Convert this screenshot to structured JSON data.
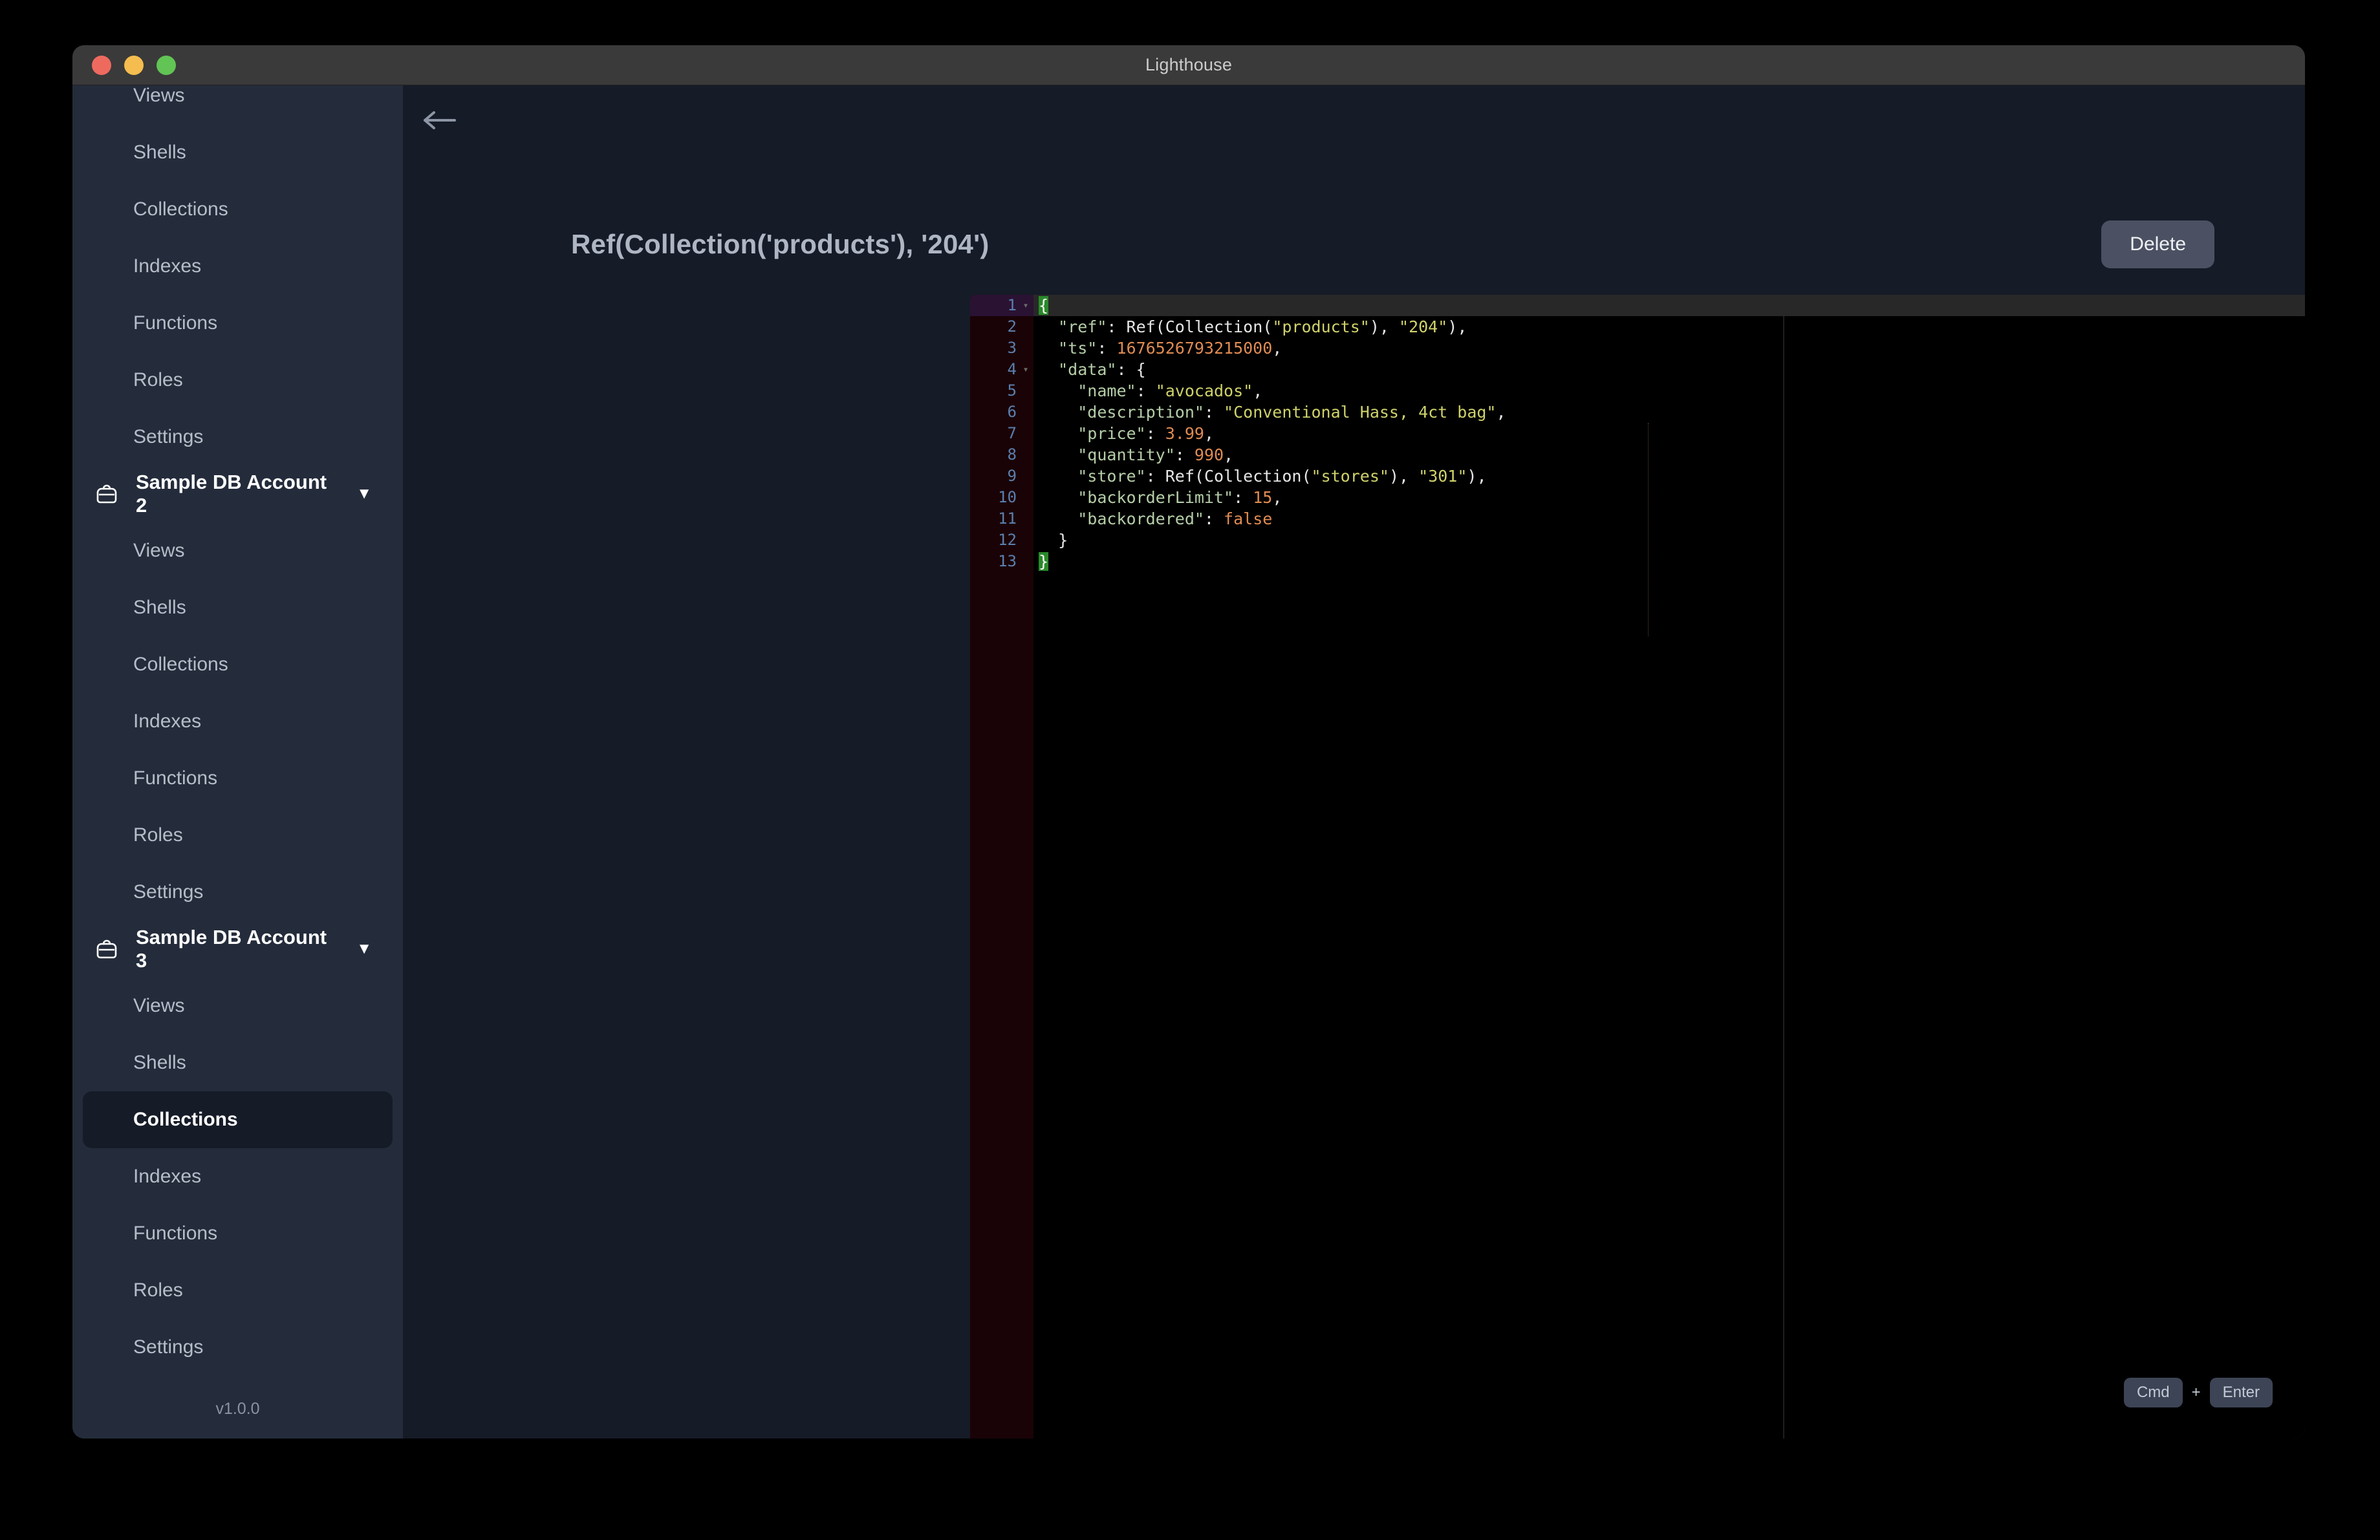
{
  "window": {
    "title": "Lighthouse",
    "traffic_lights": [
      "close-red",
      "minimize-yellow",
      "maximize-green"
    ]
  },
  "sidebar": {
    "version": "v1.0.0",
    "groups": [
      {
        "account": null,
        "items": [
          {
            "label": "Views",
            "active": false
          },
          {
            "label": "Shells",
            "active": false
          },
          {
            "label": "Collections",
            "active": false
          },
          {
            "label": "Indexes",
            "active": false
          },
          {
            "label": "Functions",
            "active": false
          },
          {
            "label": "Roles",
            "active": false
          },
          {
            "label": "Settings",
            "active": false
          }
        ]
      },
      {
        "account": "Sample DB Account 2",
        "caret": "▼",
        "items": [
          {
            "label": "Views",
            "active": false
          },
          {
            "label": "Shells",
            "active": false
          },
          {
            "label": "Collections",
            "active": false
          },
          {
            "label": "Indexes",
            "active": false
          },
          {
            "label": "Functions",
            "active": false
          },
          {
            "label": "Roles",
            "active": false
          },
          {
            "label": "Settings",
            "active": false
          }
        ]
      },
      {
        "account": "Sample DB Account 3",
        "caret": "▼",
        "items": [
          {
            "label": "Views",
            "active": false
          },
          {
            "label": "Shells",
            "active": false
          },
          {
            "label": "Collections",
            "active": true
          },
          {
            "label": "Indexes",
            "active": false
          },
          {
            "label": "Functions",
            "active": false
          },
          {
            "label": "Roles",
            "active": false
          },
          {
            "label": "Settings",
            "active": false
          }
        ]
      }
    ]
  },
  "main": {
    "back_arrow": "←",
    "page_title": "Ref(Collection('products'), '204')",
    "delete_label": "Delete"
  },
  "editor": {
    "lines": [
      {
        "n": "1",
        "fold": "▾",
        "active": true
      },
      {
        "n": "2",
        "fold": "",
        "active": false
      },
      {
        "n": "3",
        "fold": "",
        "active": false
      },
      {
        "n": "4",
        "fold": "▾",
        "active": false
      },
      {
        "n": "5",
        "fold": "",
        "active": false
      },
      {
        "n": "6",
        "fold": "",
        "active": false
      },
      {
        "n": "7",
        "fold": "",
        "active": false
      },
      {
        "n": "8",
        "fold": "",
        "active": false
      },
      {
        "n": "9",
        "fold": "",
        "active": false
      },
      {
        "n": "10",
        "fold": "",
        "active": false
      },
      {
        "n": "11",
        "fold": "",
        "active": false
      },
      {
        "n": "12",
        "fold": "",
        "active": false
      },
      {
        "n": "13",
        "fold": "",
        "active": false
      }
    ],
    "document": {
      "ref": "Ref(Collection(\"products\"), \"204\")",
      "ts": "1676526793215000",
      "data": {
        "name": "avocados",
        "description": "Conventional Hass, 4ct bag",
        "price": "3.99",
        "quantity": "990",
        "store": "Ref(Collection(\"stores\"), \"301\")",
        "backorderLimit": "15",
        "backordered": "false"
      }
    },
    "raw_text": "{\n  \"ref\": Ref(Collection(\"products\"), \"204\"),\n  \"ts\": 1676526793215000,\n  \"data\": {\n    \"name\": \"avocados\",\n    \"description\": \"Conventional Hass, 4ct bag\",\n    \"price\": 3.99,\n    \"quantity\": 990,\n    \"store\": Ref(Collection(\"stores\"), \"301\"),\n    \"backorderLimit\": 15,\n    \"backordered\": false\n  }\n}"
  },
  "shortcut": {
    "key1": "Cmd",
    "plus": "+",
    "key2": "Enter"
  },
  "colors": {
    "window_chrome": "#3a3a3a",
    "sidebar_bg": "#242c3b",
    "main_bg": "#151b27",
    "editor_bg": "#000000",
    "gutter_bg": "#1a0306",
    "active_line": "#282828",
    "accent_green": "#2a8a2a",
    "delete_btn": "#4b5162"
  }
}
